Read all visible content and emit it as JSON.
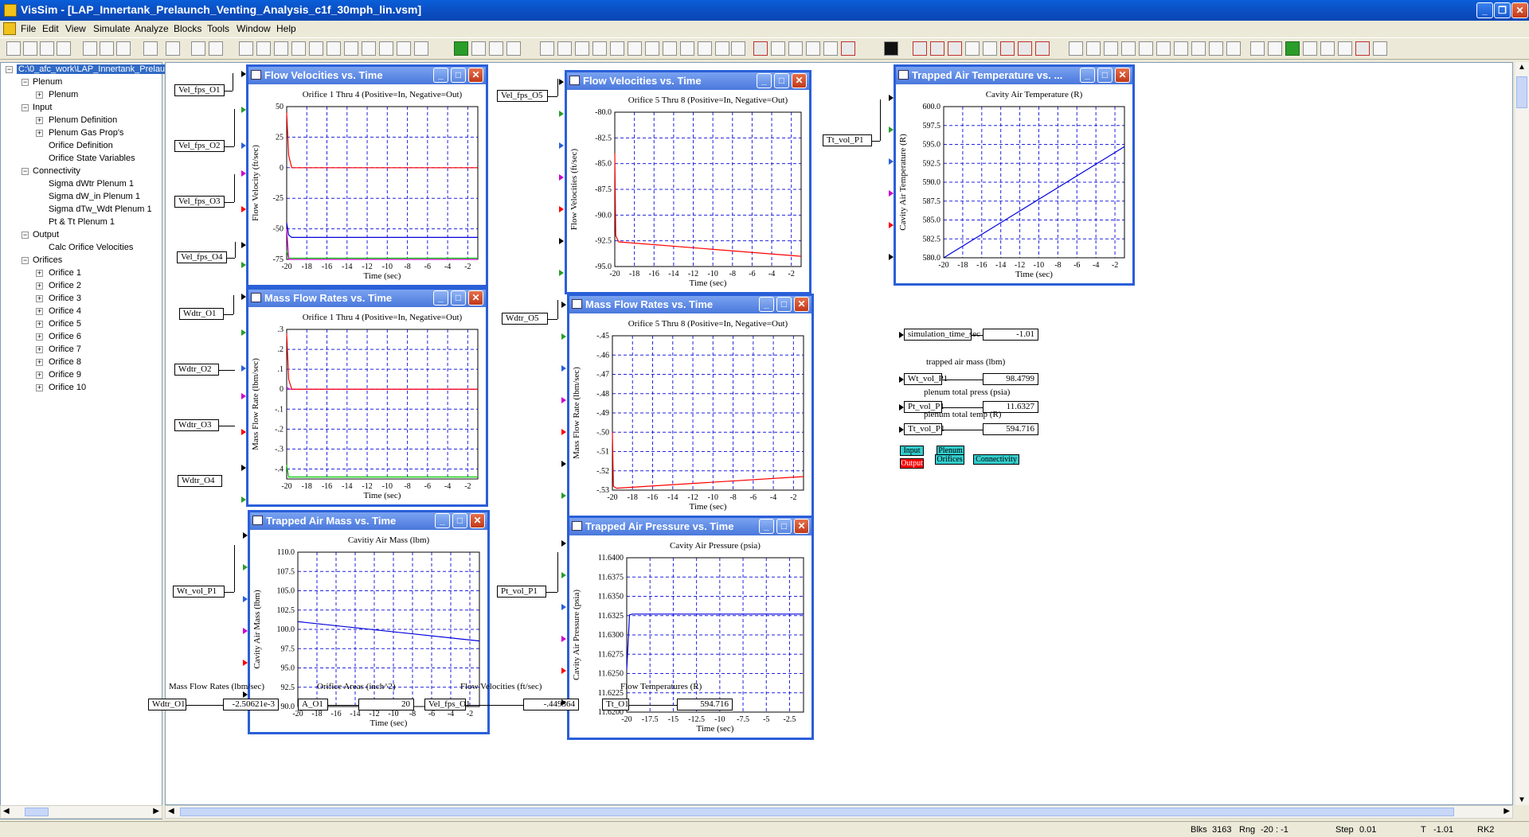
{
  "app": {
    "title": "VisSim - [LAP_Innertank_Prelaunch_Venting_Analysis_c1f_30mph_lin.vsm]",
    "menu": [
      "File",
      "Edit",
      "View",
      "Simulate",
      "Analyze",
      "Blocks",
      "Tools",
      "Window",
      "Help"
    ]
  },
  "tree": {
    "root": "C:\\0_afc_work\\LAP_Innertank_Prelau",
    "items": [
      {
        "label": "Plenum",
        "level": 1,
        "sign": "−"
      },
      {
        "label": "Plenum",
        "level": 2,
        "sign": "+"
      },
      {
        "label": "Input",
        "level": 1,
        "sign": "−"
      },
      {
        "label": "Plenum Definition",
        "level": 2,
        "sign": "+"
      },
      {
        "label": "Plenum Gas Prop's",
        "level": 2,
        "sign": "+"
      },
      {
        "label": "Orifice Definition",
        "level": 2,
        "sign": ""
      },
      {
        "label": "Orifice State Variables",
        "level": 2,
        "sign": ""
      },
      {
        "label": "Connectivity",
        "level": 1,
        "sign": "−"
      },
      {
        "label": "Sigma dWtr Plenum 1",
        "level": 2,
        "sign": ""
      },
      {
        "label": "Sigma dW_in Plenum 1",
        "level": 2,
        "sign": ""
      },
      {
        "label": "Sigma dTw_Wdt Plenum 1",
        "level": 2,
        "sign": ""
      },
      {
        "label": "Pt & Tt Plenum 1",
        "level": 2,
        "sign": ""
      },
      {
        "label": "Output",
        "level": 1,
        "sign": "−"
      },
      {
        "label": "Calc Orifice Velocities",
        "level": 2,
        "sign": ""
      },
      {
        "label": "Orifices",
        "level": 1,
        "sign": "−"
      },
      {
        "label": "Orifice 1",
        "level": 2,
        "sign": "+"
      },
      {
        "label": "Orifice 2",
        "level": 2,
        "sign": "+"
      },
      {
        "label": "Orifice 3",
        "level": 2,
        "sign": "+"
      },
      {
        "label": "Orifice 4",
        "level": 2,
        "sign": "+"
      },
      {
        "label": "Orifice 5",
        "level": 2,
        "sign": "+"
      },
      {
        "label": "Orifice 6",
        "level": 2,
        "sign": "+"
      },
      {
        "label": "Orifice 7",
        "level": 2,
        "sign": "+"
      },
      {
        "label": "Orifice 8",
        "level": 2,
        "sign": "+"
      },
      {
        "label": "Orifice 9",
        "level": 2,
        "sign": "+"
      },
      {
        "label": "Orifice 10",
        "level": 2,
        "sign": "+"
      }
    ]
  },
  "blocks": {
    "vel1": "Vel_fps_O1",
    "vel2": "Vel_fps_O2",
    "vel3": "Vel_fps_O3",
    "vel4": "Vel_fps_O4",
    "vel5": "Vel_fps_O5",
    "wdtr1": "Wdtr_O1",
    "wdtr2": "Wdtr_O2",
    "wdtr3": "Wdtr_O3",
    "wdtr4": "Wdtr_O4",
    "wdtr5": "Wdtr_O5",
    "wt_vol": "Wt_vol_P1",
    "pt_vol": "Pt_vol_P1",
    "tt_vol": "Tt_vol_P1"
  },
  "readouts": {
    "sim_time_label": "simulation_time_sec",
    "sim_time_value": "-1.01",
    "trapped_mass_label": "trapped air mass (lbm)",
    "wt_label": "Wt_vol_P1",
    "wt_value": "98.4799",
    "pt_caption": "plenum total press (psia)",
    "pt_label": "Pt_vol_P1",
    "pt_value": "11.6327",
    "tt_caption": "plenum total temp (R)",
    "tt_label": "Tt_vol_P1",
    "tt_value": "594.716"
  },
  "nav_buttons": {
    "input": "Input",
    "plenum": "Plenum",
    "output": "Output",
    "orifices": "Orifices",
    "connectivity": "Connectivity"
  },
  "bottom": {
    "h1": "Mass Flow Rates (lbm/sec)",
    "h2": "Orifice Areas (inch^2)",
    "h3": "Flow Velocities (ft/sec)",
    "h4": "Flow Temperatures (R)",
    "r1_label": "Wdtr_O1",
    "r1_value": "-2.50621e-3",
    "r2_label": "A_O1",
    "r2_value": "20",
    "r3_label": "Vel_fps_O1",
    "r3_value": "-.449364",
    "r4_label": "Tt_O1",
    "r4_value": "594.716"
  },
  "status": {
    "blks_label": "Blks",
    "blks": "3163",
    "rng_label": "Rng",
    "rng": "-20 : -1",
    "step_label": "Step",
    "step": "0.01",
    "t_label": "T",
    "t": "-1.01",
    "method": "RK2"
  },
  "colors": {
    "plot_frame": "#2a5fd8",
    "grid": "#2222dd",
    "red": "#ff0000",
    "blue": "#0000dd",
    "green": "#00cc00",
    "magenta": "#cc00cc",
    "nav_cyan": "#33cccc",
    "nav_red": "#ff0000"
  },
  "plots": [
    {
      "id": "p1",
      "title": "Flow Velocities vs. Time",
      "subtitle": "Orifice 1 Thru 4 (Positive=In, Negative=Out)",
      "ylabel": "Flow Velocity (ft/sec)",
      "xlabel": "Time (sec)",
      "xlim": [
        -20,
        -1
      ],
      "ylim": [
        -75,
        50
      ],
      "xticks": [
        "-20",
        "-18",
        "-16",
        "-14",
        "-12",
        "-10",
        "-8",
        "-6",
        "-4",
        "-2"
      ],
      "xtickvals": [
        -20,
        -18,
        -16,
        -14,
        -12,
        -10,
        -8,
        -6,
        -4,
        -2
      ],
      "yticks": [
        "50",
        "25",
        "0",
        "-25",
        "-50",
        "-75"
      ],
      "ytickvals": [
        50,
        25,
        0,
        -25,
        -50,
        -75
      ],
      "series": [
        {
          "color": "#ff0000",
          "x": [
            -20,
            -19.8,
            -19.5,
            -1
          ],
          "y": [
            45,
            10,
            0,
            0
          ]
        },
        {
          "color": "#0000dd",
          "x": [
            -20,
            -19.8,
            -19.5,
            -1
          ],
          "y": [
            -45,
            -55,
            -57,
            -57
          ]
        },
        {
          "color": "#00cc00",
          "x": [
            -20,
            -19.8,
            -19.5,
            -1
          ],
          "y": [
            -68,
            -74,
            -74,
            -74
          ]
        },
        {
          "color": "#cc00cc",
          "x": [
            -20,
            -19.8,
            -19.5,
            -1
          ],
          "y": [
            -50,
            -75,
            -75,
            -75
          ]
        }
      ]
    },
    {
      "id": "p2",
      "title": "Mass Flow Rates vs. Time",
      "subtitle": "Orifice 1 Thru 4 (Positive=In, Negative=Out)",
      "ylabel": "Mass Flow Rate (lbm/sec)",
      "xlabel": "Time (sec)",
      "xlim": [
        -20,
        -1
      ],
      "ylim": [
        -0.45,
        0.3
      ],
      "xticks": [
        "-20",
        "-18",
        "-16",
        "-14",
        "-12",
        "-10",
        "-8",
        "-6",
        "-4",
        "-2"
      ],
      "xtickvals": [
        -20,
        -18,
        -16,
        -14,
        -12,
        -10,
        -8,
        -6,
        -4,
        -2
      ],
      "yticks": [
        ".3",
        ".2",
        ".1",
        "0",
        "-.1",
        "-.2",
        "-.3",
        "-.4"
      ],
      "ytickvals": [
        0.3,
        0.2,
        0.1,
        0,
        -0.1,
        -0.2,
        -0.3,
        -0.4
      ],
      "series": [
        {
          "color": "#cc00cc",
          "x": [
            -20,
            -19.7,
            -1
          ],
          "y": [
            0.01,
            0,
            0
          ]
        },
        {
          "color": "#ff0000",
          "x": [
            -20,
            -19.8,
            -19.5,
            -1
          ],
          "y": [
            0.28,
            0.05,
            0,
            0
          ]
        },
        {
          "color": "#00cc00",
          "x": [
            -20,
            -19.8,
            -19.5,
            -1
          ],
          "y": [
            -0.38,
            -0.44,
            -0.44,
            -0.44
          ]
        }
      ]
    },
    {
      "id": "p3",
      "title": "Trapped Air Mass vs. Time",
      "subtitle": "Cavitiy Air Mass (lbm)",
      "ylabel": "Cavity Air Mass (lbm)",
      "xlabel": "Time (sec)",
      "xlim": [
        -20,
        -1
      ],
      "ylim": [
        90,
        110
      ],
      "xticks": [
        "-20",
        "-18",
        "-16",
        "-14",
        "-12",
        "-10",
        "-8",
        "-6",
        "-4",
        "-2"
      ],
      "xtickvals": [
        -20,
        -18,
        -16,
        -14,
        -12,
        -10,
        -8,
        -6,
        -4,
        -2
      ],
      "yticks": [
        "110.0",
        "107.5",
        "105.0",
        "102.5",
        "100.0",
        "97.5",
        "95.0",
        "92.5",
        "90.0"
      ],
      "ytickvals": [
        110,
        107.5,
        105,
        102.5,
        100,
        97.5,
        95,
        92.5,
        90
      ],
      "series": [
        {
          "color": "#0000dd",
          "x": [
            -20,
            -1
          ],
          "y": [
            101,
            98.5
          ]
        }
      ]
    },
    {
      "id": "p4",
      "title": "Flow Velocities vs. Time",
      "subtitle": "Orifice 5 Thru 8 (Positive=In, Negative=Out)",
      "ylabel": "Flow Velocities (ft/sec)",
      "xlabel": "Time (sec)",
      "xlim": [
        -20,
        -1
      ],
      "ylim": [
        -95,
        -80
      ],
      "xticks": [
        "-20",
        "-18",
        "-16",
        "-14",
        "-12",
        "-10",
        "-8",
        "-6",
        "-4",
        "-2"
      ],
      "xtickvals": [
        -20,
        -18,
        -16,
        -14,
        -12,
        -10,
        -8,
        -6,
        -4,
        -2
      ],
      "yticks": [
        "-80.0",
        "-82.5",
        "-85.0",
        "-87.5",
        "-90.0",
        "-92.5",
        "-95.0"
      ],
      "ytickvals": [
        -80,
        -82.5,
        -85,
        -87.5,
        -90,
        -92.5,
        -95
      ],
      "series": [
        {
          "color": "#ff0000",
          "x": [
            -20,
            -19.9,
            -19.6,
            -1
          ],
          "y": [
            -84,
            -92,
            -92.6,
            -94
          ]
        }
      ]
    },
    {
      "id": "p5",
      "title": "Mass Flow Rates vs. Time",
      "subtitle": "Orifice 5 Thru 8 (Positive=In, Negative=Out)",
      "ylabel": "Mass Flow Rate (lbm/sec)",
      "xlabel": "Time (sec)",
      "xlim": [
        -20,
        -1
      ],
      "ylim": [
        -0.53,
        -0.45
      ],
      "xticks": [
        "-20",
        "-18",
        "-16",
        "-14",
        "-12",
        "-10",
        "-8",
        "-6",
        "-4",
        "-2"
      ],
      "xtickvals": [
        -20,
        -18,
        -16,
        -14,
        -12,
        -10,
        -8,
        -6,
        -4,
        -2
      ],
      "yticks": [
        "-.45",
        "-.46",
        "-.47",
        "-.48",
        "-.49",
        "-.50",
        "-.51",
        "-.52",
        "-.53"
      ],
      "ytickvals": [
        -0.45,
        -0.46,
        -0.47,
        -0.48,
        -0.49,
        -0.5,
        -0.51,
        -0.52,
        -0.53
      ],
      "series": [
        {
          "color": "#ff0000",
          "x": [
            -20,
            -19.9,
            -19.6,
            -1
          ],
          "y": [
            -0.5,
            -0.528,
            -0.529,
            -0.523
          ]
        }
      ]
    },
    {
      "id": "p6",
      "title": "Trapped Air Pressure vs. Time",
      "subtitle": "Cavity Air Pressure (psia)",
      "ylabel": "Cavity Air Pressure (psia)",
      "xlabel": "Time (sec)",
      "xlim": [
        -20,
        -1
      ],
      "ylim": [
        11.62,
        11.64
      ],
      "xticks": [
        "-20",
        "-17.5",
        "-15",
        "-12.5",
        "-10",
        "-7.5",
        "-5",
        "-2.5"
      ],
      "xtickvals": [
        -20,
        -17.5,
        -15,
        -12.5,
        -10,
        -7.5,
        -5,
        -2.5
      ],
      "yticks": [
        "11.6400",
        "11.6375",
        "11.6350",
        "11.6325",
        "11.6300",
        "11.6275",
        "11.6250",
        "11.6225",
        "11.6200"
      ],
      "ytickvals": [
        11.64,
        11.6375,
        11.635,
        11.6325,
        11.63,
        11.6275,
        11.625,
        11.6225,
        11.62
      ],
      "series": [
        {
          "color": "#0000dd",
          "x": [
            -20,
            -19.7,
            -19.4,
            -1
          ],
          "y": [
            11.6255,
            11.6326,
            11.6327,
            11.6327
          ]
        }
      ]
    },
    {
      "id": "p7",
      "title": "Trapped Air Temperature vs. ...",
      "subtitle": "Cavity Air Temperature (R)",
      "ylabel": "Cavity Air Temperature (R)",
      "xlabel": "Time (sec)",
      "xlim": [
        -20,
        -1
      ],
      "ylim": [
        580,
        600
      ],
      "xticks": [
        "-20",
        "-18",
        "-16",
        "-14",
        "-12",
        "-10",
        "-8",
        "-6",
        "-4",
        "-2"
      ],
      "xtickvals": [
        -20,
        -18,
        -16,
        -14,
        -12,
        -10,
        -8,
        -6,
        -4,
        -2
      ],
      "yticks": [
        "600.0",
        "597.5",
        "595.0",
        "592.5",
        "590.0",
        "587.5",
        "585.0",
        "582.5",
        "580.0"
      ],
      "ytickvals": [
        600,
        597.5,
        595,
        592.5,
        590,
        587.5,
        585,
        582.5,
        580
      ],
      "series": [
        {
          "color": "#0000dd",
          "x": [
            -20,
            -1
          ],
          "y": [
            580,
            594.7
          ]
        }
      ]
    }
  ]
}
